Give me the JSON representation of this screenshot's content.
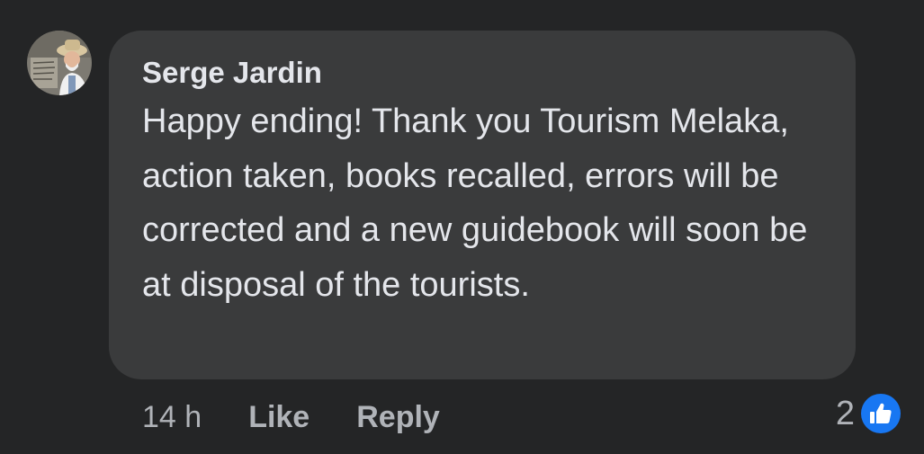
{
  "comment": {
    "author": "Serge Jardin",
    "text": "Happy ending! Thank you Tourism Melaka, action taken, books recalled, errors will be corrected and a new guidebook will soon be at disposal of the tourists.",
    "timestamp": "14 h",
    "like_label": "Like",
    "reply_label": "Reply",
    "reaction_count": "2",
    "reaction_icon": "thumbs-up-icon",
    "colors": {
      "background": "#242526",
      "bubble": "#3a3b3c",
      "text": "#e4e6eb",
      "muted": "#b0b3b8",
      "like_blue": "#1877f2"
    }
  }
}
